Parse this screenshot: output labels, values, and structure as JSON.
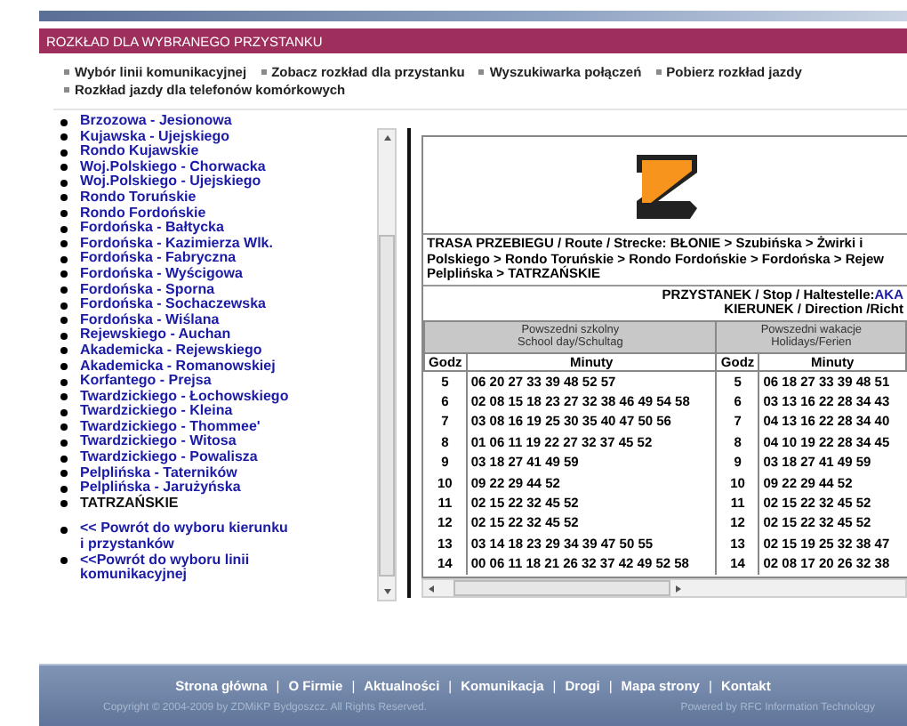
{
  "header": {
    "title": "ROZKŁAD DLA WYBRANEGO PRZYSTANKU"
  },
  "nav_links": [
    "Wybór linii komunikacyjnej",
    "Zobacz rozkład dla przystanku",
    "Wyszukiwarka połączeń",
    "Pobierz rozkład jazdy",
    "Rozkład jazdy dla telefonów komórkowych"
  ],
  "stops": [
    {
      "label": "Brzozowa - Jesionowa",
      "current": false
    },
    {
      "label": "Kujawska - Ujejskiego",
      "current": false
    },
    {
      "label": "Rondo Kujawskie",
      "current": false
    },
    {
      "label": "Woj.Polskiego - Chorwacka",
      "current": false
    },
    {
      "label": "Woj.Polskiego - Ujejskiego",
      "current": false
    },
    {
      "label": "Rondo Toruńskie",
      "current": false
    },
    {
      "label": "Rondo Fordońskie",
      "current": false
    },
    {
      "label": "Fordońska - Bałtycka",
      "current": false
    },
    {
      "label": "Fordońska - Kazimierza Wlk.",
      "current": false
    },
    {
      "label": "Fordońska - Fabryczna",
      "current": false
    },
    {
      "label": "Fordońska - Wyścigowa",
      "current": false
    },
    {
      "label": "Fordońska - Sporna",
      "current": false
    },
    {
      "label": "Fordońska - Sochaczewska",
      "current": false
    },
    {
      "label": "Fordońska - Wiślana",
      "current": false
    },
    {
      "label": "Rejewskiego - Auchan",
      "current": false
    },
    {
      "label": "Akademicka - Rejewskiego",
      "current": false
    },
    {
      "label": "Akademicka - Romanowskiej",
      "current": false
    },
    {
      "label": "Korfantego - Prejsa",
      "current": false
    },
    {
      "label": "Twardzickiego - Łochowskiego",
      "current": false
    },
    {
      "label": "Twardzickiego - Kleina",
      "current": false
    },
    {
      "label": "Twardzickiego - Thommee'",
      "current": false
    },
    {
      "label": "Twardzickiego - Witosa",
      "current": false
    },
    {
      "label": "Twardzickiego - Powalisza",
      "current": false
    },
    {
      "label": "Pelplińska - Taterników",
      "current": false
    },
    {
      "label": "Pelplińska - Jarużyńska",
      "current": false
    },
    {
      "label": "TATRZAŃSKIE",
      "current": true
    }
  ],
  "back_links": [
    "<< Powrót do wyboru kierunku i przystanków",
    "<<Powrót do wyboru linii komunikacyjnej"
  ],
  "timetable": {
    "route_lines": [
      "TRASA PRZEBIEGU / Route / Strecke: BŁONIE > Szubińska > Żwirki i",
      "Polskiego > Rondo Toruńskie > Rondo Fordońskie > Fordońska > Rejew",
      "Pelplińska > TATRZAŃSKIE"
    ],
    "stop_label": "PRZYSTANEK / Stop / Haltestelle:",
    "stop_value": "AKA",
    "direction": "KIERUNEK / Direction /Richt",
    "day_types": [
      [
        "Powszedni szkolny",
        "School day/Schultag"
      ],
      [
        "Powszedni wakacje",
        "Holidays/Ferien"
      ]
    ],
    "columns": [
      "Godz",
      "Minuty",
      "Godz",
      "Minuty"
    ],
    "rows": [
      [
        "5",
        "06 20 27 33 39 48 52 57",
        "5",
        "06 18 27 33 39 48 51"
      ],
      [
        "6",
        "02 08 15 18 23 27 32 38 46 49 54 58",
        "6",
        "03 13 16 22 28 34 43"
      ],
      [
        "7",
        "03 08 16 19 25 30 35 40 47 50 56",
        "7",
        "04 13 16 22 28 34 40"
      ],
      [
        "8",
        "01 06 11 19 22 27 32 37 45 52",
        "8",
        "04 10 19 22 28 34 45"
      ],
      [
        "9",
        "03 18 27 41 49 59",
        "9",
        "03 18 27 41 49 59"
      ],
      [
        "10",
        "09 22 29 44 52",
        "10",
        "09 22 29 44 52"
      ],
      [
        "11",
        "02 15 22 32 45 52",
        "11",
        "02 15 22 32 45 52"
      ],
      [
        "12",
        "02 15 22 32 45 52",
        "12",
        "02 15 22 32 45 52"
      ],
      [
        "13",
        "03 14 18 23 29 34 39 47 50 55",
        "13",
        "02 15 19 25 32 38 47"
      ],
      [
        "14",
        "00 06 11 18 21 26 32 37 42 49 52 58",
        "14",
        "02 08 17 20 26 32 38"
      ]
    ]
  },
  "footer": {
    "items": [
      {
        "kind": "link",
        "text": "Strona główna"
      },
      {
        "kind": "separator",
        "text": "|"
      },
      {
        "kind": "link",
        "text": "O Firmie"
      },
      {
        "kind": "separator",
        "text": "|"
      },
      {
        "kind": "link",
        "text": "Aktualności"
      },
      {
        "kind": "separator",
        "text": "|"
      },
      {
        "kind": "link",
        "text": "Komunikacja"
      },
      {
        "kind": "separator",
        "text": "|"
      },
      {
        "kind": "link",
        "text": "Drogi"
      },
      {
        "kind": "separator",
        "text": "|"
      },
      {
        "kind": "link",
        "text": "Mapa strony"
      },
      {
        "kind": "separator",
        "text": "|"
      },
      {
        "kind": "link",
        "text": "Kontakt"
      }
    ],
    "copyright": "Copyright © 2004-2009 by ZDMiKP Bydgoszcz. All Rights Reserved.",
    "powered_by": "Powered by RFC Information Technology"
  }
}
